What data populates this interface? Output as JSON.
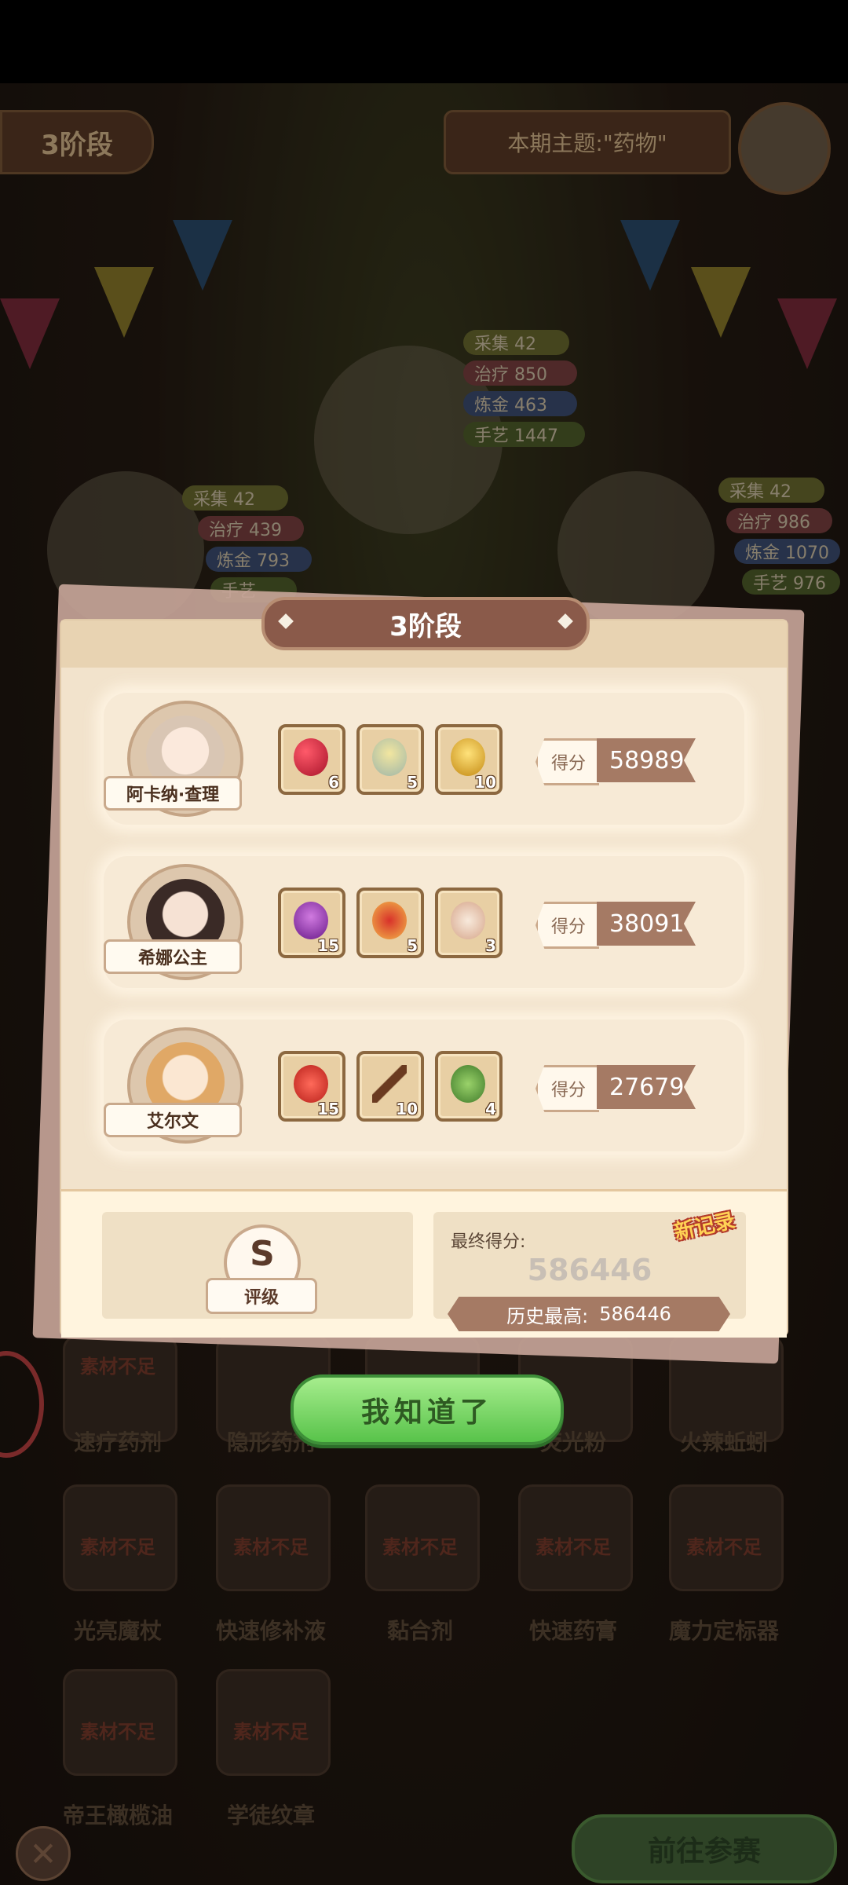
{
  "header": {
    "stage_chip": "3阶段",
    "theme": "本期主题:\"药物\""
  },
  "background_stats": {
    "center": [
      "采集 42",
      "治疗 850",
      "炼金 463",
      "手艺 1447"
    ],
    "left": [
      "采集 42",
      "治疗 439",
      "炼金 793",
      "手艺"
    ],
    "right": [
      "采集 42",
      "治疗 986",
      "炼金 1070",
      "手艺 976"
    ]
  },
  "background_grid": {
    "row1_labels": [
      "速疗药剂",
      "隐形药剂",
      "",
      "荧光粉",
      "火辣蚯蚓"
    ],
    "row2_labels": [
      "光亮魔杖",
      "快速修补液",
      "黏合剂",
      "快速药膏",
      "魔力定标器"
    ],
    "row3_labels": [
      "帝王橄榄油",
      "学徒纹章"
    ],
    "shortage_note": "素材不足"
  },
  "modal": {
    "title": "3阶段",
    "rows": [
      {
        "name": "阿卡纳·查理",
        "items": [
          {
            "icon": "heart-potion-icon",
            "qty": "6"
          },
          {
            "icon": "soup-bowl-icon",
            "qty": "5"
          },
          {
            "icon": "golden-incense-icon",
            "qty": "10"
          }
        ],
        "score_label": "得分",
        "score": "58989"
      },
      {
        "name": "希娜公主",
        "items": [
          {
            "icon": "purple-herb-icon",
            "qty": "15"
          },
          {
            "icon": "jam-jar-icon",
            "qty": "5"
          },
          {
            "icon": "ointment-tube-icon",
            "qty": "3"
          }
        ],
        "score_label": "得分",
        "score": "38091"
      },
      {
        "name": "艾尔文",
        "items": [
          {
            "icon": "red-powder-icon",
            "qty": "15"
          },
          {
            "icon": "magic-wand-icon",
            "qty": "10"
          },
          {
            "icon": "green-vine-icon",
            "qty": "4"
          }
        ],
        "score_label": "得分",
        "score": "27679"
      }
    ],
    "rank": {
      "letter": "S",
      "label": "评级"
    },
    "final": {
      "label": "最终得分:",
      "value": "586446",
      "new_record": "新记录",
      "history_label": "历史最高:",
      "history_value": "586446"
    },
    "ok_button": "我知道了"
  },
  "footer": {
    "go_button": "前往参赛"
  },
  "colors": {
    "score_bar": "#a57a64",
    "ok_green": "#58c34a",
    "panel": "#f2e3cc"
  }
}
